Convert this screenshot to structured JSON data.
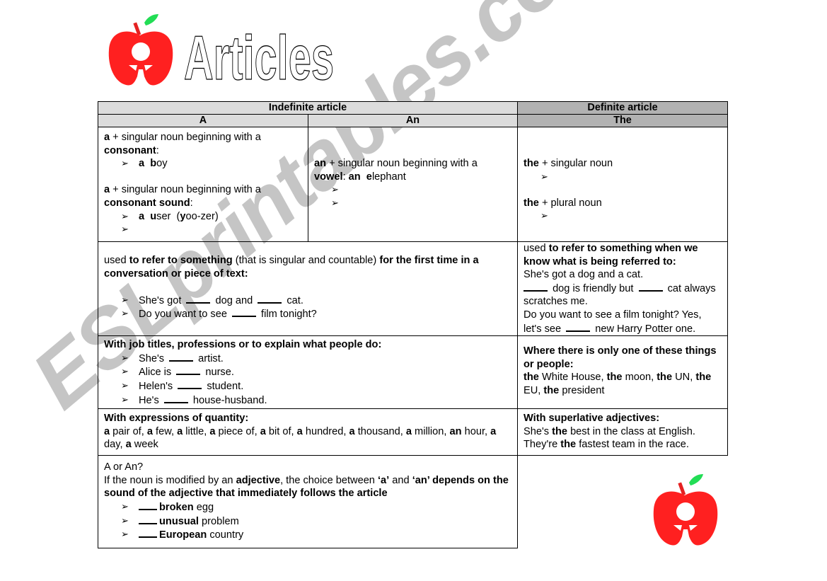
{
  "document": {
    "title": "Articles",
    "watermark": "ESLprintables.com",
    "colors": {
      "apple_red": "#ff2020",
      "leaf_green": "#22dd55",
      "header_light": "#dcdcdc",
      "header_dark": "#b2b2b2"
    }
  },
  "table": {
    "headers": {
      "indefinite": "Indefinite article",
      "definite": "Definite article",
      "a": "A",
      "an": "An",
      "the": "The"
    },
    "row1": {
      "a": {
        "rule1_bold": "a",
        "rule1_text": " + singular noun beginning with a ",
        "rule1_bold2": "consonant",
        "rule1_colon": ":",
        "example1_bold": "a  b",
        "example1_text": "oy",
        "rule2_bold": "a",
        "rule2_text": " + singular noun beginning with a ",
        "rule2_bold2": "consonant sound",
        "rule2_colon": ":",
        "example2_bold": "a  u",
        "example2_text": "ser  (",
        "example2_bold2": "y",
        "example2_text2": "oo-zer)",
        "example3": ""
      },
      "an": {
        "rule_bold": "an",
        "rule_text": " + singular noun beginning with a ",
        "rule_bold2": "vowel",
        "rule_text2": ": ",
        "rule_bold3": "an  e",
        "rule_text3": "lephant",
        "example1": "",
        "example2": ""
      },
      "the": {
        "rule1_bold": "the",
        "rule1_text": " + singular noun",
        "example1": "",
        "rule2_bold": "the",
        "rule2_text": " + plural noun",
        "example2": ""
      }
    },
    "row2": {
      "indef": {
        "t1": "used ",
        "b1": "to refer to something",
        "t2": " (that is singular and countable) ",
        "b2": "for the first time in a conversation or piece of text:",
        "ex1_a": "She's got ",
        "ex1_b": " dog and ",
        "ex1_c": " cat.",
        "ex2_a": "Do you want to see ",
        "ex2_b": " film tonight?"
      },
      "def": {
        "t1": "used ",
        "b1": "to refer to something when we know what is being referred to:",
        "line1": "She's got a dog and a cat.",
        "line2_b": " dog is friendly but ",
        "line2_c": " cat always scratches me.",
        "line3": "Do you want to see a film tonight? Yes, let's see ",
        "line3_b": " new Harry Potter one."
      }
    },
    "row3": {
      "indef": {
        "heading": "With job titles, professions or to explain what people do:",
        "examples": [
          {
            "before": "She's ",
            "after": " artist."
          },
          {
            "before": "Alice is ",
            "after": " nurse."
          },
          {
            "before": "Helen's ",
            "after": " student."
          },
          {
            "before": "He's ",
            "after": " house-husband."
          }
        ]
      },
      "def": {
        "heading": "Where there is only one of these things or people:",
        "items": [
          {
            "bold": "the",
            "text": " White House, "
          },
          {
            "bold": "the",
            "text": " moon, "
          },
          {
            "bold": "the",
            "text": " UN, "
          },
          {
            "bold": "the",
            "text": " EU, "
          },
          {
            "bold": "the",
            "text": " president"
          }
        ]
      }
    },
    "row4": {
      "indef": {
        "heading": "With expressions of quantity:",
        "items": [
          {
            "bold": "a",
            "text": " pair of, "
          },
          {
            "bold": "a",
            "text": " few, "
          },
          {
            "bold": "a",
            "text": " little, "
          },
          {
            "bold": "a",
            "text": " piece of, "
          },
          {
            "bold": "a",
            "text": " bit of, "
          },
          {
            "bold": "a",
            "text": " hundred, "
          },
          {
            "bold": "a",
            "text": " thousand, "
          },
          {
            "bold": "a",
            "text": " million, "
          },
          {
            "bold": "an",
            "text": " hour, "
          },
          {
            "bold": "a",
            "text": " day, "
          },
          {
            "bold": "a",
            "text": " week"
          }
        ]
      },
      "def": {
        "heading": "With superlative adjectives:",
        "line1_a": "She's ",
        "line1_b": "the",
        "line1_c": " best in the class at English.",
        "line2_a": "They're ",
        "line2_b": "the",
        "line2_c": " fastest team in the race."
      }
    },
    "row5": {
      "heading": "A or An?",
      "t1": "If the noun is modified by an ",
      "b1": "adjective",
      "t2": ", the choice between ",
      "b2": "‘a’",
      "t3": " and ",
      "b3": "‘an’",
      "b4": " depends on the sound of the adjective that immediately follows the article",
      "examples": [
        {
          "bold": "broken",
          "text": " egg"
        },
        {
          "bold": "unusual",
          "text": " problem"
        },
        {
          "bold": "European",
          "text": " country"
        }
      ]
    }
  }
}
